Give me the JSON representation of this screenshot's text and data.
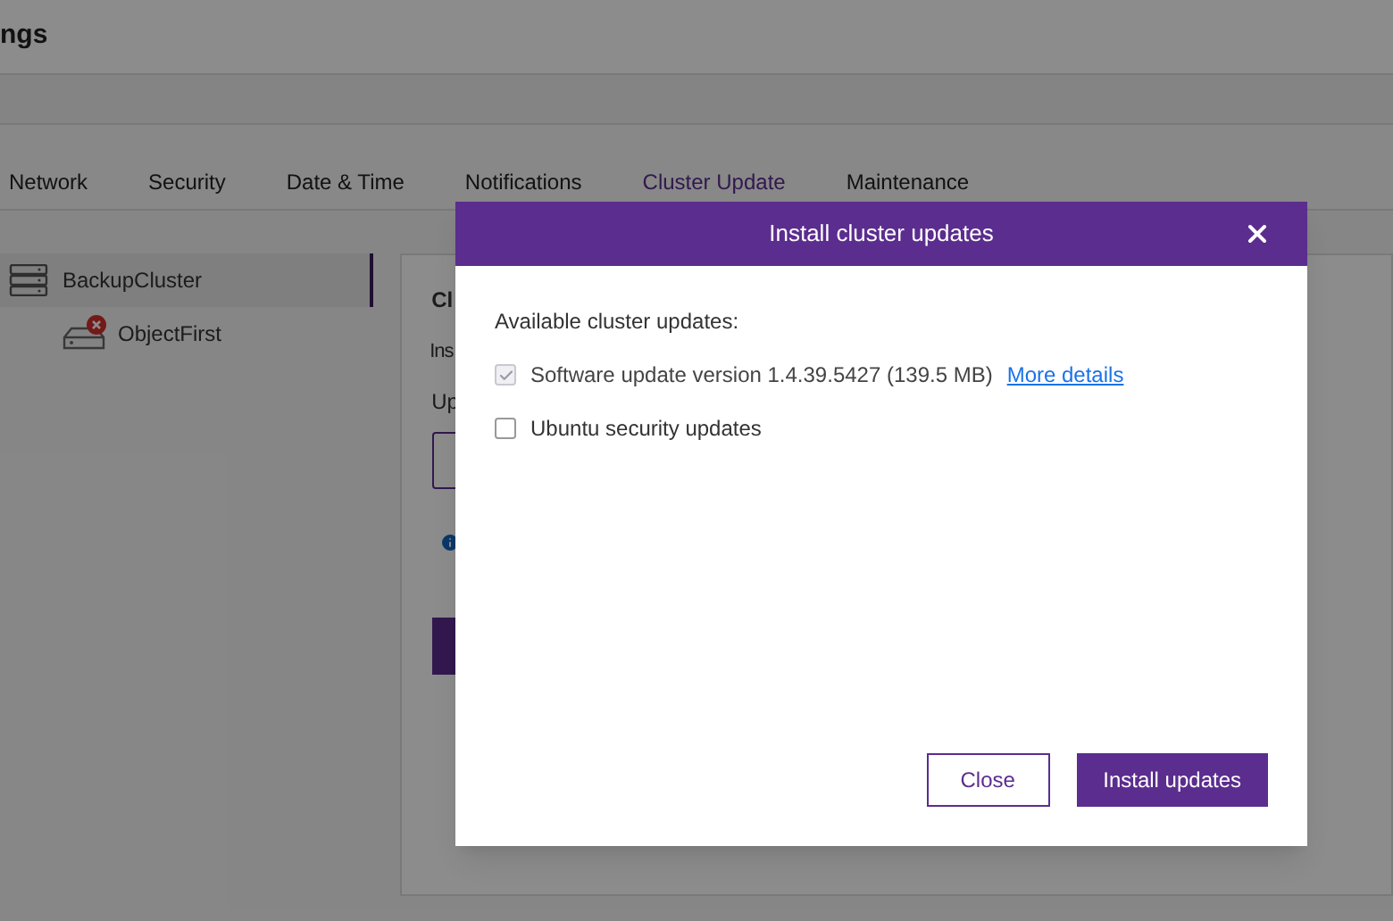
{
  "page": {
    "title": "ngs"
  },
  "tabs": [
    {
      "label": "Network",
      "selected": false
    },
    {
      "label": "Security",
      "selected": false
    },
    {
      "label": "Date & Time",
      "selected": false
    },
    {
      "label": "Notifications",
      "selected": false
    },
    {
      "label": "Cluster Update",
      "selected": true
    },
    {
      "label": "Maintenance",
      "selected": false
    }
  ],
  "tree": [
    {
      "label": "BackupCluster",
      "selected": true,
      "children": [
        {
          "label": "ObjectFirst",
          "error": true
        }
      ]
    }
  ],
  "panel": {
    "heading": "Cl",
    "line_1": "Ins",
    "line_2": "Up"
  },
  "dialog": {
    "title": "Install cluster updates",
    "intro": "Available cluster updates:",
    "updates": [
      {
        "label": "Software update version 1.4.39.5427 (139.5 MB)",
        "checked": true,
        "disabled": true,
        "link": "More details"
      },
      {
        "label": "Ubuntu security updates",
        "checked": false,
        "disabled": false
      }
    ],
    "buttons": [
      {
        "label": "Close",
        "kind": "secondary"
      },
      {
        "label": "Install updates",
        "kind": "primary"
      }
    ]
  }
}
